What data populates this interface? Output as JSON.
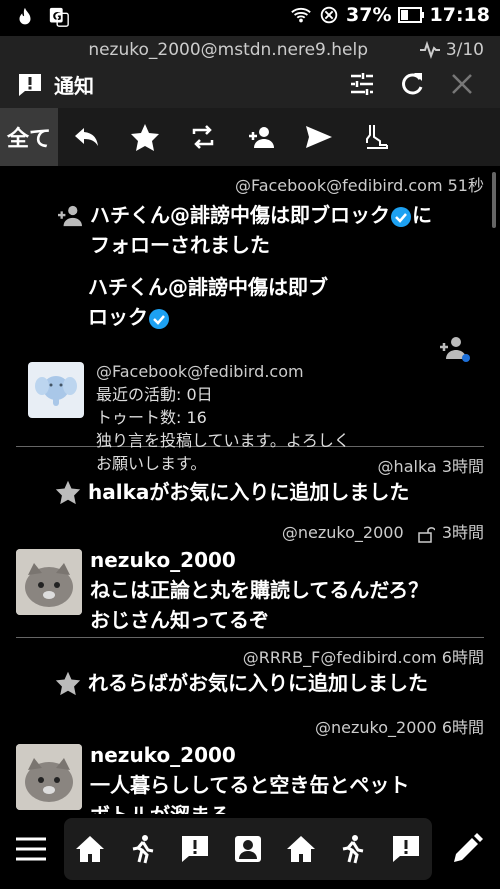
{
  "status": {
    "battery": "37%",
    "time": "17:18"
  },
  "header": {
    "account": "nezuko_2000@mstdn.nere9.help",
    "counter": "3/10",
    "title": "通知"
  },
  "filter": {
    "all_label": "全て"
  },
  "notifications": [
    {
      "meta": "@Facebook@fedibird.com 51秒",
      "line1": "ハチくん@誹謗中傷は即ブロック",
      "line1_tail": "に",
      "line2": "フォローされました",
      "card": {
        "name1": "ハチくん@誹謗中傷は即ブ",
        "name2": "ロック",
        "handle": "@Facebook@fedibird.com",
        "last_activity": "最近の活動: 0日",
        "toots": "トゥート数: 16",
        "bio1": "独り言を投稿しています。よろしく",
        "bio2": "お願いします。"
      }
    },
    {
      "meta": "@halka 3時間",
      "text": "halkaがお気に入りに追加しました"
    },
    {
      "meta": "@nezuko_2000",
      "meta_time": "3時間",
      "author": "nezuko_2000",
      "line1": "ねこは正論と丸を購読してるんだろ？",
      "line2": "おじさん知ってるぞ"
    },
    {
      "meta": "@RRRB_F@fedibird.com 6時間",
      "text": "れるらばがお気に入りに追加しました"
    },
    {
      "meta": "@nezuko_2000 6時間",
      "author": "nezuko_2000",
      "line1": "一人暮らししてると空き缶とペット",
      "line2": "ボトルが溜まる"
    }
  ],
  "colors": {
    "accent": "#1da1f2",
    "header_bg": "#222222",
    "tab_active": "#3a3a3a"
  }
}
